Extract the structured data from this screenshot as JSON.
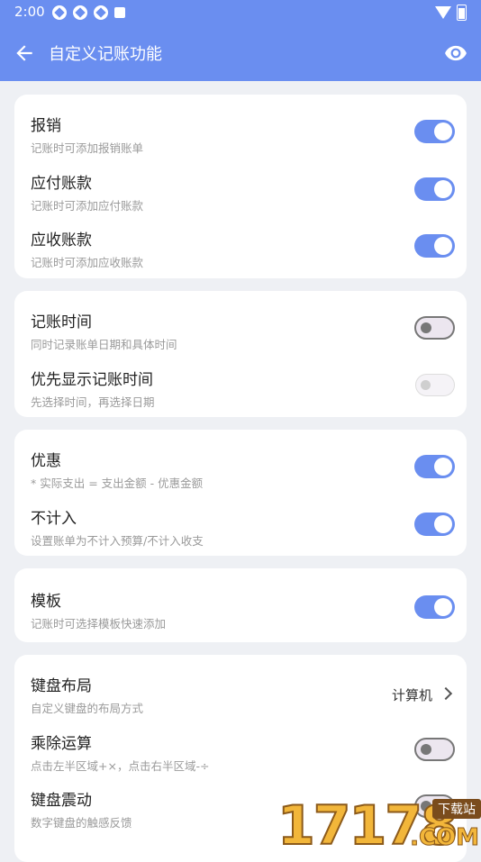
{
  "status_bar": {
    "time": "2:00"
  },
  "app_bar": {
    "title": "自定义记账功能"
  },
  "groups": [
    {
      "rows": [
        {
          "title": "报销",
          "subtitle": "记账时可添加报销账单",
          "toggle": "on"
        },
        {
          "title": "应付账款",
          "subtitle": "记账时可添加应付账款",
          "toggle": "on"
        },
        {
          "title": "应收账款",
          "subtitle": "记账时可添加应收账款",
          "toggle": "on"
        }
      ]
    },
    {
      "rows": [
        {
          "title": "记账时间",
          "subtitle": "同时记录账单日期和具体时间",
          "toggle": "off"
        },
        {
          "title": "优先显示记账时间",
          "subtitle": "先选择时间，再选择日期",
          "toggle": "disabled"
        }
      ]
    },
    {
      "rows": [
        {
          "title": "优惠",
          "subtitle": "* 实际支出 = 支出金额 - 优惠金额",
          "toggle": "on"
        },
        {
          "title": "不计入",
          "subtitle": "设置账单为不计入预算/不计入收支",
          "toggle": "on"
        }
      ]
    },
    {
      "rows": [
        {
          "title": "模板",
          "subtitle": "记账时可选择模板快速添加",
          "toggle": "on"
        }
      ]
    },
    {
      "rows": [
        {
          "title": "键盘布局",
          "subtitle": "自定义键盘的布局方式",
          "value": "计算机"
        },
        {
          "title": "乘除运算",
          "subtitle": "点击左半区域+×，点击右半区域-÷",
          "toggle": "off"
        },
        {
          "title": "键盘震动",
          "subtitle": "数字键盘的触感反馈",
          "toggle": "off"
        }
      ]
    }
  ],
  "watermark": {
    "number": "17178",
    "download": "下载站",
    "com": ".COM"
  },
  "colors": {
    "accent": "#6a8ef0",
    "background": "#eef0f4"
  }
}
